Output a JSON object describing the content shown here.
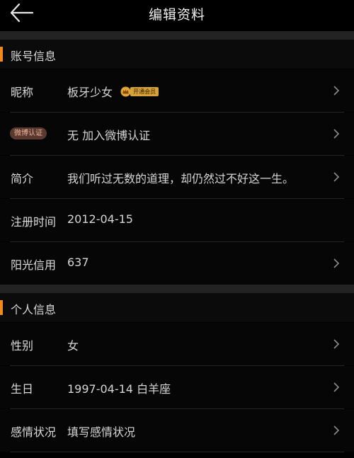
{
  "header": {
    "title": "编辑资料"
  },
  "sections": {
    "account": {
      "title": "账号信息",
      "nickname": {
        "label": "昵称",
        "value": "板牙少女",
        "vip_badge": "开通会员"
      },
      "weibo": {
        "label": "微博认证",
        "value": "无 加入微博认证"
      },
      "intro": {
        "label": "简介",
        "value": "我们听过无数的道理，却仍然过不好这一生。"
      },
      "register": {
        "label": "注册时间",
        "value": "2012-04-15"
      },
      "credit": {
        "label": "阳光信用",
        "value": "637"
      }
    },
    "personal": {
      "title": "个人信息",
      "gender": {
        "label": "性别",
        "value": "女"
      },
      "birthday": {
        "label": "生日",
        "value": "1997-04-14 白羊座"
      },
      "relationship": {
        "label": "感情状况",
        "value": "填写感情状况"
      }
    }
  },
  "icons": {
    "back": "arrow-left-icon",
    "chevron": "chevron-right-icon",
    "crown": "crown-icon"
  },
  "colors": {
    "accent": "#f08a1c",
    "background": "#000000",
    "vip_gold": "#d7a23a"
  }
}
